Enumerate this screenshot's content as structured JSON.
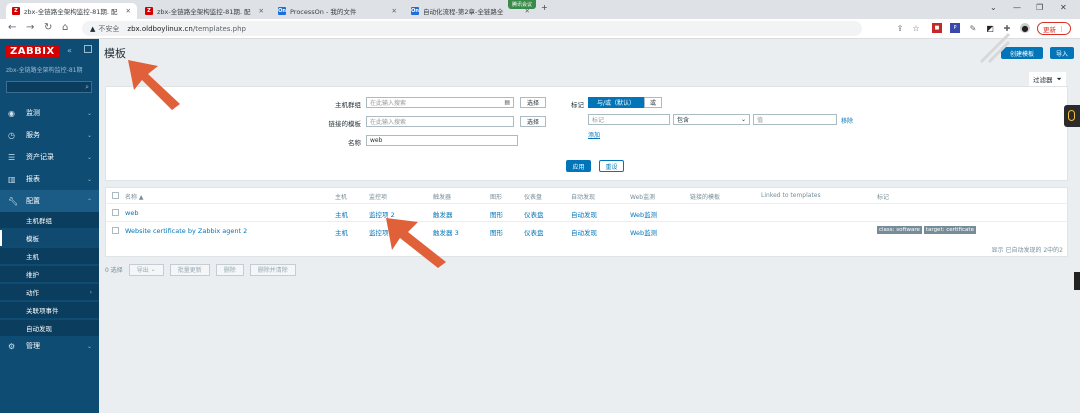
{
  "browser": {
    "tabs": [
      {
        "icon": "Z",
        "label": "zbx-全链路全架构监控-81期. 配",
        "active": true
      },
      {
        "icon": "Z",
        "label": "zbx-全链路全架构监控-81期. 配",
        "active": false
      },
      {
        "icon": "On",
        "label": "ProcessOn - 我的文件",
        "active": false
      },
      {
        "icon": "On",
        "label": "自动化流程-第2章-全链路全",
        "active": false
      }
    ],
    "meeting_badge": "腾讯会议",
    "insecure_label": "不安全",
    "url_host": "zbx.oldboylinux.cn",
    "url_path": "/templates.php",
    "update_label": "更新"
  },
  "sidebar": {
    "logo": "ZABBIX",
    "server_name": "zbx-全链路全架构监控-81期",
    "menu": [
      {
        "icon": "eye-icon",
        "label": "监测"
      },
      {
        "icon": "clock-icon",
        "label": "服务"
      },
      {
        "icon": "list-icon",
        "label": "资产记录"
      },
      {
        "icon": "chart-icon",
        "label": "报表"
      },
      {
        "icon": "wrench-icon",
        "label": "配置"
      }
    ],
    "submenu": [
      "主机群组",
      "模板",
      "主机",
      "维护",
      "动作",
      "关联项事件",
      "自动发现"
    ],
    "admin": "管理"
  },
  "header": {
    "title": "模板",
    "create_button": "创建模板",
    "import_button": "导入"
  },
  "filter": {
    "tab_label": "过滤器",
    "host_groups_label": "主机群组",
    "host_groups_placeholder": "在此输入搜索",
    "linked_templates_label": "链接的模板",
    "linked_templates_placeholder": "在此输入搜索",
    "select_button": "选择",
    "name_label": "名称",
    "name_value": "web",
    "tags_label": "标记",
    "and_or": "与/或（默认）",
    "or": "或",
    "tag_placeholder": "标记",
    "operator": "包含",
    "value_placeholder": "值",
    "remove": "移除",
    "add": "添加",
    "apply": "应用",
    "reset": "重设"
  },
  "table": {
    "headers": [
      "名称 ▲",
      "主机",
      "监控项",
      "触发器",
      "图形",
      "仪表盘",
      "自动发现",
      "Web监测",
      "链接的模板",
      "Linked to templates",
      "标记"
    ],
    "rows": [
      {
        "name": "web",
        "hosts": "主机",
        "items": "监控项 2",
        "triggers": "触发器",
        "graphs": "图形",
        "dashboards": "仪表盘",
        "discovery": "自动发现",
        "web": "Web监测",
        "tags": []
      },
      {
        "name": "Website certificate by Zabbix agent 2",
        "hosts": "主机",
        "items": "监控项 1",
        "triggers": "触发器 3",
        "graphs": "图形",
        "dashboards": "仪表盘",
        "discovery": "自动发现",
        "web": "Web监测",
        "tags": [
          "class: software",
          "target: certificate"
        ]
      }
    ],
    "count": "显示 已自动发现的 2中的2"
  },
  "actions": {
    "selected": "0 选择",
    "buttons": [
      "导出",
      "批量更新",
      "删除",
      "删除并清除"
    ]
  },
  "colors": {
    "accent": "#0275b8",
    "sidebar": "#0e4c74",
    "logo": "#d40000",
    "annotation_arrow": "#e0603a"
  }
}
